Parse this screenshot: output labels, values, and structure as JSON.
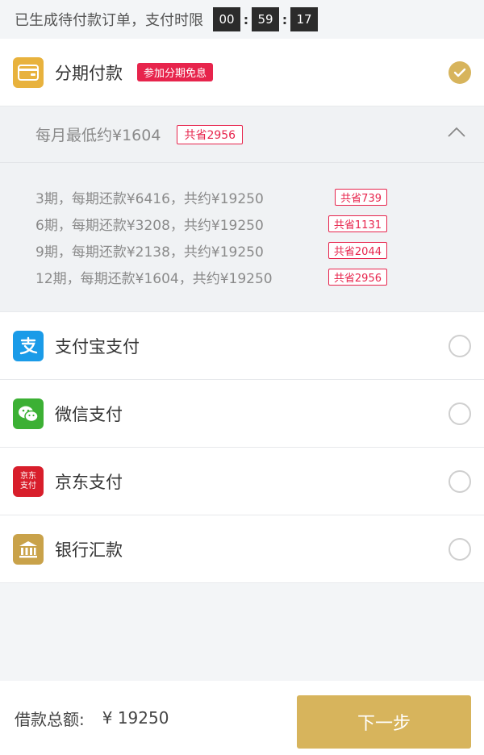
{
  "topbar": {
    "notice": "已生成待付款订单，支付时限",
    "timer": {
      "hh": "00",
      "mm": "59",
      "ss": "17"
    }
  },
  "installment": {
    "label": "分期付款",
    "promo_badge": "参加分期免息",
    "min_monthly": "每月最低约¥1604",
    "total_save": "共省2956",
    "plans": [
      {
        "text": "3期，每期还款¥6416，共约¥19250",
        "save": "共省739"
      },
      {
        "text": "6期，每期还款¥3208，共约¥19250",
        "save": "共省1131"
      },
      {
        "text": "9期，每期还款¥2138，共约¥19250",
        "save": "共省2044"
      },
      {
        "text": "12期，每期还款¥1604，共约¥19250",
        "save": "共省2956"
      }
    ]
  },
  "methods": {
    "alipay": "支付宝支付",
    "wechat": "微信支付",
    "jd": "京东支付",
    "jd_icon_line1": "京东",
    "jd_icon_line2": "支付",
    "bank": "银行汇款"
  },
  "icons": {
    "installment": "card-icon",
    "alipay": "alipay-icon",
    "wechat": "wechat-icon",
    "jd": "jd-pay-icon",
    "bank": "bank-icon"
  },
  "colors": {
    "accent_gold": "#d7b45c",
    "promo_red": "#e7244c",
    "alipay_blue": "#1a9be8",
    "wechat_green": "#3cb034",
    "jd_red": "#d81e2b"
  },
  "footer": {
    "amount_label": "借款总额:",
    "amount_value": "¥ 19250",
    "next_label": "下一步"
  }
}
